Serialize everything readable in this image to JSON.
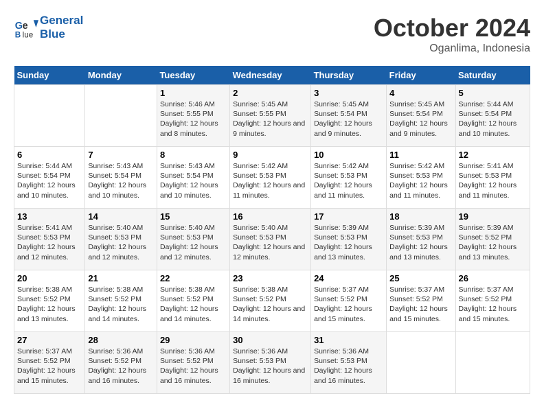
{
  "logo": {
    "line1": "General",
    "line2": "Blue"
  },
  "title": "October 2024",
  "location": "Oganlima, Indonesia",
  "headers": [
    "Sunday",
    "Monday",
    "Tuesday",
    "Wednesday",
    "Thursday",
    "Friday",
    "Saturday"
  ],
  "weeks": [
    [
      {
        "day": "",
        "sunrise": "",
        "sunset": "",
        "daylight": ""
      },
      {
        "day": "",
        "sunrise": "",
        "sunset": "",
        "daylight": ""
      },
      {
        "day": "1",
        "sunrise": "Sunrise: 5:46 AM",
        "sunset": "Sunset: 5:55 PM",
        "daylight": "Daylight: 12 hours and 8 minutes."
      },
      {
        "day": "2",
        "sunrise": "Sunrise: 5:45 AM",
        "sunset": "Sunset: 5:55 PM",
        "daylight": "Daylight: 12 hours and 9 minutes."
      },
      {
        "day": "3",
        "sunrise": "Sunrise: 5:45 AM",
        "sunset": "Sunset: 5:54 PM",
        "daylight": "Daylight: 12 hours and 9 minutes."
      },
      {
        "day": "4",
        "sunrise": "Sunrise: 5:45 AM",
        "sunset": "Sunset: 5:54 PM",
        "daylight": "Daylight: 12 hours and 9 minutes."
      },
      {
        "day": "5",
        "sunrise": "Sunrise: 5:44 AM",
        "sunset": "Sunset: 5:54 PM",
        "daylight": "Daylight: 12 hours and 10 minutes."
      }
    ],
    [
      {
        "day": "6",
        "sunrise": "Sunrise: 5:44 AM",
        "sunset": "Sunset: 5:54 PM",
        "daylight": "Daylight: 12 hours and 10 minutes."
      },
      {
        "day": "7",
        "sunrise": "Sunrise: 5:43 AM",
        "sunset": "Sunset: 5:54 PM",
        "daylight": "Daylight: 12 hours and 10 minutes."
      },
      {
        "day": "8",
        "sunrise": "Sunrise: 5:43 AM",
        "sunset": "Sunset: 5:54 PM",
        "daylight": "Daylight: 12 hours and 10 minutes."
      },
      {
        "day": "9",
        "sunrise": "Sunrise: 5:42 AM",
        "sunset": "Sunset: 5:53 PM",
        "daylight": "Daylight: 12 hours and 11 minutes."
      },
      {
        "day": "10",
        "sunrise": "Sunrise: 5:42 AM",
        "sunset": "Sunset: 5:53 PM",
        "daylight": "Daylight: 12 hours and 11 minutes."
      },
      {
        "day": "11",
        "sunrise": "Sunrise: 5:42 AM",
        "sunset": "Sunset: 5:53 PM",
        "daylight": "Daylight: 12 hours and 11 minutes."
      },
      {
        "day": "12",
        "sunrise": "Sunrise: 5:41 AM",
        "sunset": "Sunset: 5:53 PM",
        "daylight": "Daylight: 12 hours and 11 minutes."
      }
    ],
    [
      {
        "day": "13",
        "sunrise": "Sunrise: 5:41 AM",
        "sunset": "Sunset: 5:53 PM",
        "daylight": "Daylight: 12 hours and 12 minutes."
      },
      {
        "day": "14",
        "sunrise": "Sunrise: 5:40 AM",
        "sunset": "Sunset: 5:53 PM",
        "daylight": "Daylight: 12 hours and 12 minutes."
      },
      {
        "day": "15",
        "sunrise": "Sunrise: 5:40 AM",
        "sunset": "Sunset: 5:53 PM",
        "daylight": "Daylight: 12 hours and 12 minutes."
      },
      {
        "day": "16",
        "sunrise": "Sunrise: 5:40 AM",
        "sunset": "Sunset: 5:53 PM",
        "daylight": "Daylight: 12 hours and 12 minutes."
      },
      {
        "day": "17",
        "sunrise": "Sunrise: 5:39 AM",
        "sunset": "Sunset: 5:53 PM",
        "daylight": "Daylight: 12 hours and 13 minutes."
      },
      {
        "day": "18",
        "sunrise": "Sunrise: 5:39 AM",
        "sunset": "Sunset: 5:53 PM",
        "daylight": "Daylight: 12 hours and 13 minutes."
      },
      {
        "day": "19",
        "sunrise": "Sunrise: 5:39 AM",
        "sunset": "Sunset: 5:52 PM",
        "daylight": "Daylight: 12 hours and 13 minutes."
      }
    ],
    [
      {
        "day": "20",
        "sunrise": "Sunrise: 5:38 AM",
        "sunset": "Sunset: 5:52 PM",
        "daylight": "Daylight: 12 hours and 13 minutes."
      },
      {
        "day": "21",
        "sunrise": "Sunrise: 5:38 AM",
        "sunset": "Sunset: 5:52 PM",
        "daylight": "Daylight: 12 hours and 14 minutes."
      },
      {
        "day": "22",
        "sunrise": "Sunrise: 5:38 AM",
        "sunset": "Sunset: 5:52 PM",
        "daylight": "Daylight: 12 hours and 14 minutes."
      },
      {
        "day": "23",
        "sunrise": "Sunrise: 5:38 AM",
        "sunset": "Sunset: 5:52 PM",
        "daylight": "Daylight: 12 hours and 14 minutes."
      },
      {
        "day": "24",
        "sunrise": "Sunrise: 5:37 AM",
        "sunset": "Sunset: 5:52 PM",
        "daylight": "Daylight: 12 hours and 15 minutes."
      },
      {
        "day": "25",
        "sunrise": "Sunrise: 5:37 AM",
        "sunset": "Sunset: 5:52 PM",
        "daylight": "Daylight: 12 hours and 15 minutes."
      },
      {
        "day": "26",
        "sunrise": "Sunrise: 5:37 AM",
        "sunset": "Sunset: 5:52 PM",
        "daylight": "Daylight: 12 hours and 15 minutes."
      }
    ],
    [
      {
        "day": "27",
        "sunrise": "Sunrise: 5:37 AM",
        "sunset": "Sunset: 5:52 PM",
        "daylight": "Daylight: 12 hours and 15 minutes."
      },
      {
        "day": "28",
        "sunrise": "Sunrise: 5:36 AM",
        "sunset": "Sunset: 5:52 PM",
        "daylight": "Daylight: 12 hours and 16 minutes."
      },
      {
        "day": "29",
        "sunrise": "Sunrise: 5:36 AM",
        "sunset": "Sunset: 5:52 PM",
        "daylight": "Daylight: 12 hours and 16 minutes."
      },
      {
        "day": "30",
        "sunrise": "Sunrise: 5:36 AM",
        "sunset": "Sunset: 5:53 PM",
        "daylight": "Daylight: 12 hours and 16 minutes."
      },
      {
        "day": "31",
        "sunrise": "Sunrise: 5:36 AM",
        "sunset": "Sunset: 5:53 PM",
        "daylight": "Daylight: 12 hours and 16 minutes."
      },
      {
        "day": "",
        "sunrise": "",
        "sunset": "",
        "daylight": ""
      },
      {
        "day": "",
        "sunrise": "",
        "sunset": "",
        "daylight": ""
      }
    ]
  ]
}
